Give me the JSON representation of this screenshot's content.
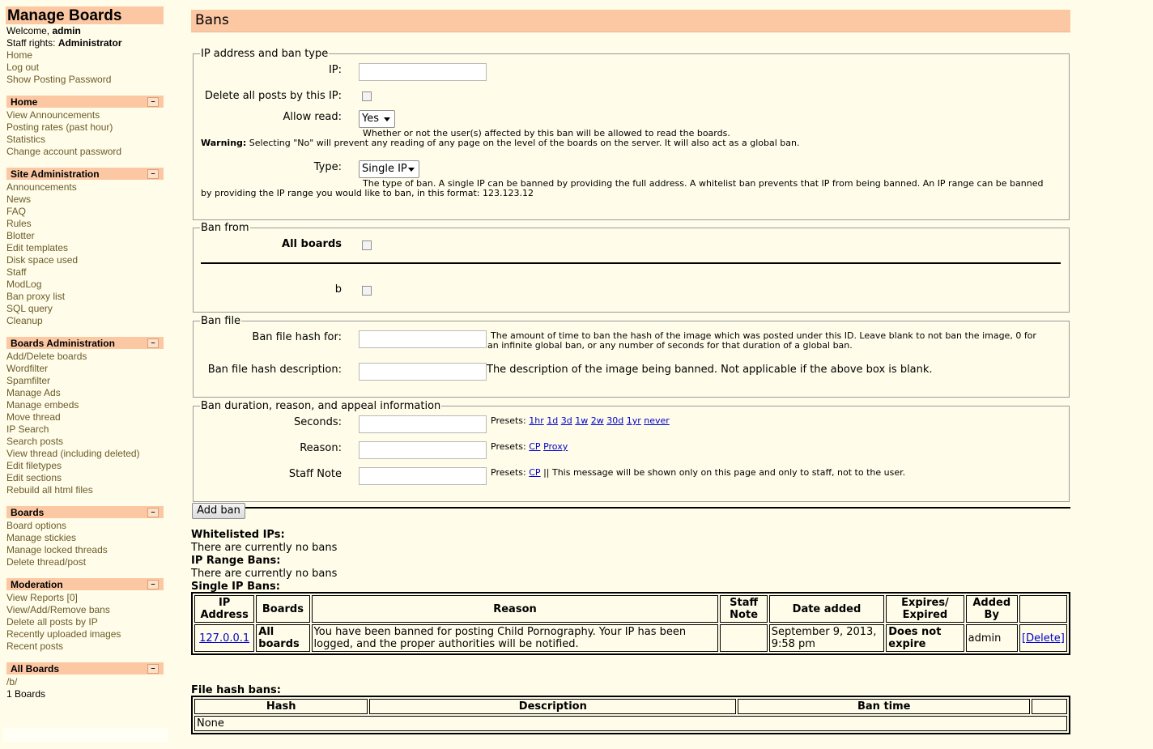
{
  "sidebar": {
    "title": "Manage Boards",
    "welcome_prefix": "Welcome, ",
    "welcome_user": "admin",
    "rights_prefix": "Staff rights: ",
    "rights_value": "Administrator",
    "top_links": [
      "Home",
      "Log out",
      "Show Posting Password"
    ],
    "toggle_symbol": "–",
    "sections": [
      {
        "title": "Home",
        "items": [
          "View Announcements",
          "Posting rates (past hour)",
          "Statistics",
          "Change account password"
        ]
      },
      {
        "title": "Site Administration",
        "items": [
          "Announcements",
          "News",
          "FAQ",
          "Rules",
          "Blotter",
          "Edit templates",
          "Disk space used",
          "Staff",
          "ModLog",
          "Ban proxy list",
          "SQL query",
          "Cleanup"
        ]
      },
      {
        "title": "Boards Administration",
        "items": [
          "Add/Delete boards",
          "Wordfilter",
          "Spamfilter",
          "Manage Ads",
          "Manage embeds",
          "Move thread",
          "IP Search",
          "Search posts",
          "View thread (including deleted)",
          "Edit filetypes",
          "Edit sections",
          "Rebuild all html files"
        ]
      },
      {
        "title": "Boards",
        "items": [
          "Board options",
          "Manage stickies",
          "Manage locked threads",
          "Delete thread/post"
        ]
      },
      {
        "title": "Moderation",
        "items": [
          "View Reports [0]",
          "View/Add/Remove bans",
          "Delete all posts by IP",
          "Recently uploaded images",
          "Recent posts"
        ]
      },
      {
        "title": "All Boards",
        "items": [
          "/b/",
          "1 Boards"
        ]
      }
    ]
  },
  "main": {
    "title": "Bans",
    "ip_section": {
      "legend": "IP address and ban type",
      "ip_label": "IP:",
      "ip_value": "",
      "delete_label": "Delete all posts by this IP:",
      "allow_read_label": "Allow read:",
      "allow_read_value": "Yes",
      "allow_read_help": "Whether or not the user(s) affected by this ban will be allowed to read the boards.",
      "warning_label": "Warning:",
      "warning_text": " Selecting \"No\" will prevent any reading of any page on the level of the boards on the server. It will also act as a global ban.",
      "type_label": "Type:",
      "type_value": "Single IP",
      "type_help_1": "The type of ban. A single IP can be banned by providing the full address. A whitelist ban prevents that IP from being banned. An IP range can be banned",
      "type_help_2": "by providing the IP range you would like to ban, in this format: 123.123.12"
    },
    "ban_from": {
      "legend": "Ban from",
      "all_boards_label": "All boards",
      "board_label": "b"
    },
    "ban_file": {
      "legend": "Ban file",
      "hash_label": "Ban file hash for:",
      "hash_help_1": "The amount of time to ban the hash of the image which was posted under this ID. Leave blank to not ban the image, 0 for",
      "hash_help_2": "an infinite global ban, or any number of seconds for that duration of a global ban.",
      "desc_label": "Ban file hash description:",
      "desc_help": "The description of the image being banned. Not applicable if the above box is blank."
    },
    "duration": {
      "legend": "Ban duration, reason, and appeal information",
      "seconds_label": "Seconds:",
      "reason_label": "Reason:",
      "note_label": "Staff Note",
      "presets_label": "Presets:",
      "seconds_presets": [
        "1hr",
        "1d",
        "3d",
        "1w",
        "2w",
        "30d",
        "1yr",
        "never"
      ],
      "reason_presets": [
        "CP",
        "Proxy"
      ],
      "note_presets": [
        "CP"
      ],
      "note_help": " || This message will be shown only on this page and only to staff, not to the user."
    },
    "add_ban_label": "Add ban",
    "whitelist_heading": "Whitelisted IPs:",
    "whitelist_text": "There are currently no bans",
    "range_heading": "IP Range Bans:",
    "range_text": "There are currently no bans",
    "single_heading": "Single IP Bans:",
    "single_table": {
      "headers": [
        "IP Address",
        "Boards",
        "Reason",
        "Staff Note",
        "Date added",
        "Expires/ Expired",
        "Added By",
        ""
      ],
      "rows": [
        {
          "ip": "127.0.0.1",
          "boards": "All boards",
          "reason": "You have been banned for posting Child Pornography. Your IP has been logged, and the proper authorities will be notified.",
          "note": "",
          "date": "September 9, 2013, 9:58 pm",
          "expires": "Does not expire",
          "added_by": "admin",
          "action": "[Delete]"
        }
      ]
    },
    "hash_heading": "File hash bans:",
    "hash_table": {
      "headers": [
        "Hash",
        "Description",
        "Ban time",
        ""
      ],
      "empty": "None"
    }
  }
}
